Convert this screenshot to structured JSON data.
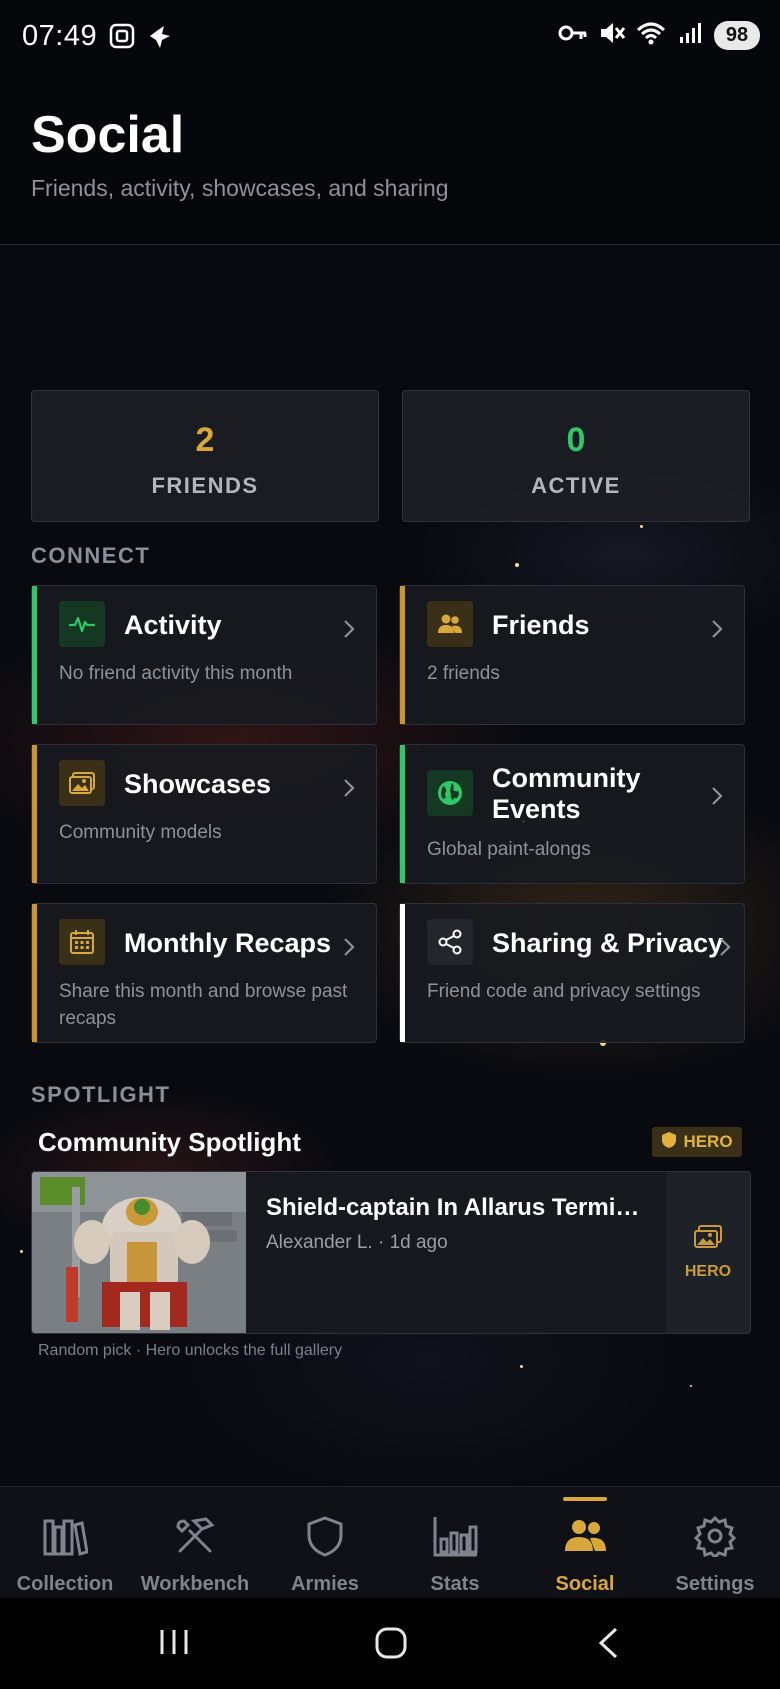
{
  "status_bar": {
    "time": "07:49",
    "battery": "98"
  },
  "header": {
    "title": "Social",
    "subtitle": "Friends, activity, showcases, and sharing"
  },
  "stats": [
    {
      "value": "2",
      "label": "FRIENDS",
      "color": "#d7a83a"
    },
    {
      "value": "0",
      "label": "ACTIVE",
      "color": "#2fc76a"
    }
  ],
  "connect": {
    "section_label": "CONNECT",
    "cards": [
      {
        "title": "Activity",
        "subtitle": "No friend activity this month",
        "accent": "#2fc76a",
        "icon": "activity-pulse-icon"
      },
      {
        "title": "Friends",
        "subtitle": "2 friends",
        "accent": "#c9962f",
        "icon": "friends-icon"
      },
      {
        "title": "Showcases",
        "subtitle": "Community models",
        "accent": "#c9962f",
        "icon": "image-icon"
      },
      {
        "title_line1": "Community",
        "title_line2": "Events",
        "subtitle": "Global paint-alongs",
        "accent": "#2fc76a",
        "icon": "globe-icon"
      },
      {
        "title": "Monthly Recaps",
        "subtitle_line1": "Share this month and browse past",
        "subtitle_line2": "recaps",
        "accent": "#c9962f",
        "icon": "calendar-icon"
      },
      {
        "title": "Sharing & Privacy",
        "subtitle": "Friend code and privacy settings",
        "accent": "#ffffff",
        "icon": "share-icon"
      }
    ]
  },
  "spotlight": {
    "section_label": "SPOTLIGHT",
    "title": "Community Spotlight",
    "badge": "HERO",
    "item": {
      "name": "Shield-captain In Allarus Termin...",
      "meta": "Alexander L. · 1d ago",
      "hero_label": "HERO"
    },
    "note": "Random pick · Hero unlocks the full gallery"
  },
  "bottom_nav": [
    {
      "label": "Collection",
      "icon": "books-icon"
    },
    {
      "label": "Workbench",
      "icon": "tools-icon"
    },
    {
      "label": "Armies",
      "icon": "shield-icon"
    },
    {
      "label": "Stats",
      "icon": "bar-chart-icon"
    },
    {
      "label": "Social",
      "icon": "people-icon",
      "active": true
    },
    {
      "label": "Settings",
      "icon": "gear-icon"
    }
  ],
  "colors": {
    "gold": "#d8a83c",
    "green": "#2fc76a",
    "background": "#06070b"
  }
}
